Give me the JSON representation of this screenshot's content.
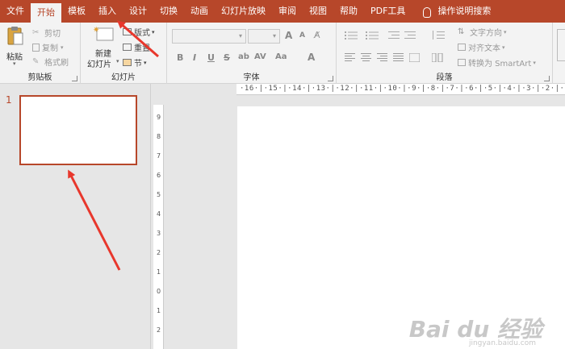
{
  "menu": {
    "file": "文件",
    "home": "开始",
    "template": "模板",
    "insert": "插入",
    "design": "设计",
    "transition": "切换",
    "animation": "动画",
    "slideshow": "幻灯片放映",
    "review": "审阅",
    "view": "视图",
    "help": "帮助",
    "pdf": "PDF工具",
    "search": "操作说明搜索"
  },
  "clipboard": {
    "paste": "粘贴",
    "cut": "剪切",
    "copy": "复制",
    "format_painter": "格式刷",
    "label": "剪贴板"
  },
  "slides": {
    "new_slide_1": "新建",
    "new_slide_2": "幻灯片",
    "layout": "版式",
    "reset": "重置",
    "section": "节",
    "label": "幻灯片"
  },
  "font": {
    "label": "字体",
    "bold": "B",
    "italic": "I",
    "underline": "U",
    "strike": "S",
    "spacing": "AV",
    "case": "Aa",
    "color": "A",
    "grow": "A",
    "shrink": "A"
  },
  "paragraph": {
    "label": "段落",
    "text_direction": "文字方向",
    "align_text": "对齐文本",
    "smartart": "转换为 SmartArt"
  },
  "thumbnail": {
    "number": "1"
  },
  "ruler": {
    "horizontal": "·16·|·15·|·14·|·13·|·12·|·11·|·10·|·9·|·8·|·7·|·6·|·5·|·4·|·3·|·2·|·1·|·",
    "vertical": [
      "9",
      "8",
      "7",
      "6",
      "5",
      "4",
      "3",
      "2",
      "1",
      "0",
      "1",
      "2"
    ]
  },
  "watermark": {
    "main": "Bai du 经验",
    "sub": "jingyan.baidu.com"
  },
  "colors": {
    "accent": "#b7472a",
    "arrow": "#e8372c"
  }
}
